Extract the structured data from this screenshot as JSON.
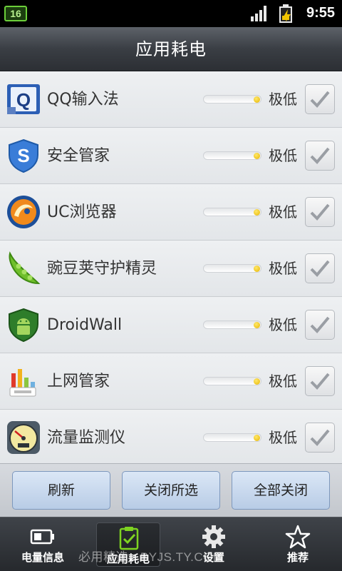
{
  "status_bar": {
    "notification_count": "16",
    "time": "9:55",
    "icons": [
      "notification-badge",
      "signal-icon",
      "battery-charging-icon"
    ]
  },
  "header": {
    "title": "应用耗电"
  },
  "apps": [
    {
      "name": "QQ输入法",
      "level": "极低",
      "icon": "qq-input-icon",
      "usage": 1.0,
      "checked": true
    },
    {
      "name": "安全管家",
      "level": "极低",
      "icon": "security-shield-icon",
      "usage": 1.0,
      "checked": true
    },
    {
      "name": "UC浏览器",
      "level": "极低",
      "icon": "uc-browser-icon",
      "usage": 1.0,
      "checked": true
    },
    {
      "name": "豌豆荚守护精灵",
      "level": "极低",
      "icon": "peapod-icon",
      "usage": 1.0,
      "checked": true
    },
    {
      "name": "DroidWall",
      "level": "极低",
      "icon": "android-shield-icon",
      "usage": 1.0,
      "checked": true
    },
    {
      "name": "上网管家",
      "level": "极低",
      "icon": "gprs-bars-icon",
      "usage": 1.0,
      "checked": true
    },
    {
      "name": "流量监测仪",
      "level": "极低",
      "icon": "speedometer-icon",
      "usage": 1.0,
      "checked": true
    }
  ],
  "actions": {
    "refresh": "刷新",
    "close_selected": "关闭所选",
    "close_all": "全部关闭"
  },
  "tabs": [
    {
      "label": "电量信息",
      "icon": "battery-icon",
      "active": false
    },
    {
      "label": "应用耗电",
      "icon": "checklist-icon",
      "active": true
    },
    {
      "label": "设置",
      "icon": "gear-icon",
      "active": false
    },
    {
      "label": "推荐",
      "icon": "star-icon",
      "active": false
    }
  ],
  "watermark": "必用精选 • BYJS.TY.COM",
  "colors": {
    "accent_yellow": "#f0c400",
    "title_bar": "#3a3e44",
    "button_blue": "#b8cce6",
    "list_bg": "#e7e9ec"
  }
}
